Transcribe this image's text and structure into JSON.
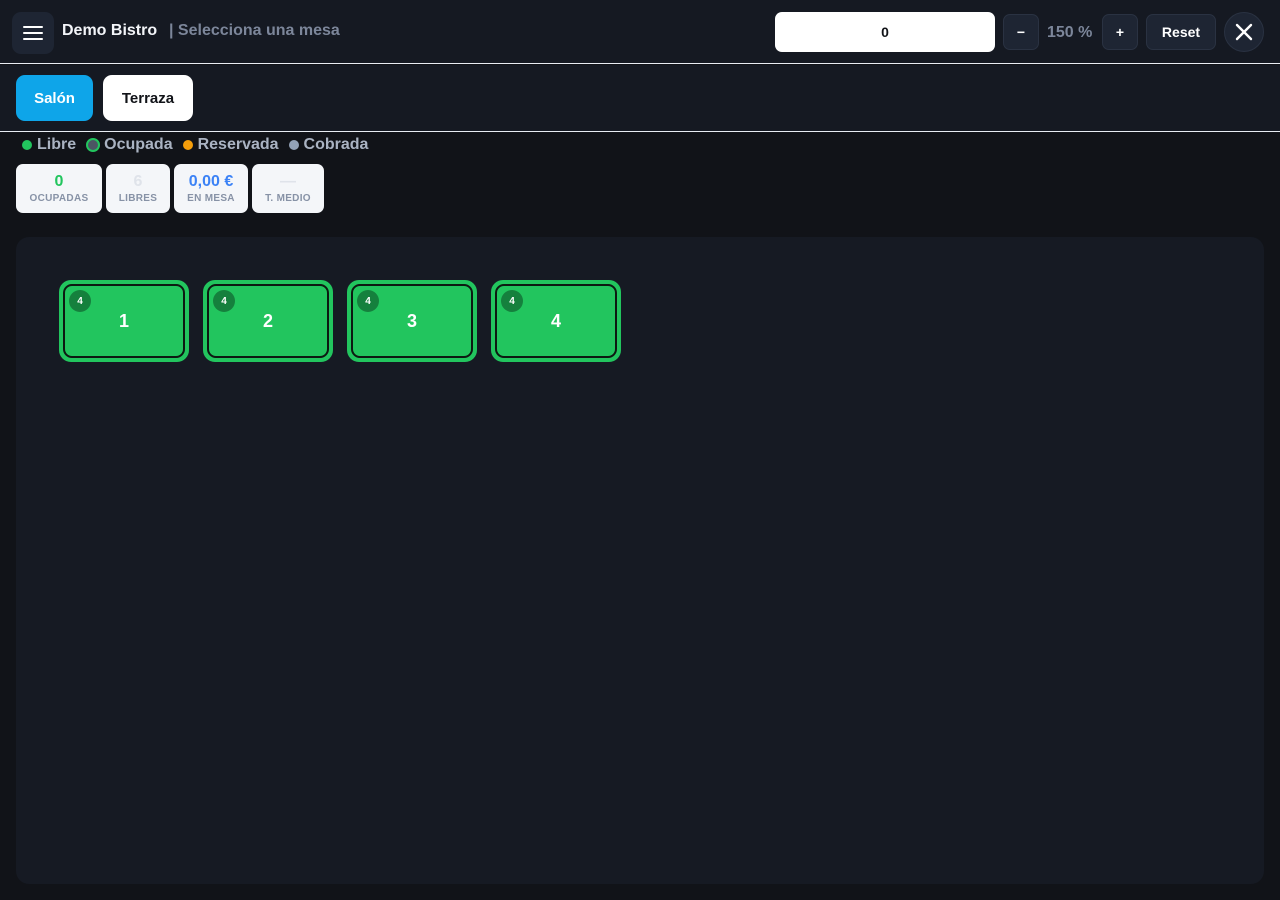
{
  "header": {
    "brand": "Demo Bistro",
    "subtitle": "| Selecciona una mesa",
    "search_value": "0",
    "zoom_out_label": "−",
    "zoom_level": "150 %",
    "zoom_in_label": "+",
    "reset_label": "Reset",
    "menu_icon": "hamburger-icon",
    "close_icon": "close-icon"
  },
  "zones": [
    {
      "label": "Salón",
      "active": true
    },
    {
      "label": "Terraza",
      "active": false
    }
  ],
  "legend": [
    {
      "label": "Libre",
      "color": "#22c55e"
    },
    {
      "label": "Ocupada",
      "color": "#4b5563"
    },
    {
      "label": "Reservada",
      "color": "#f59e0b"
    },
    {
      "label": "Cobrada",
      "color": "#94a3b8"
    }
  ],
  "stats": [
    {
      "value": "0",
      "label": "OCUPADAS",
      "color": "#22c55e"
    },
    {
      "value": "6",
      "label": "LIBRES",
      "color": "#dfe3ea"
    },
    {
      "value": "0,00 €",
      "label": "EN MESA",
      "color": "#3b82f6"
    },
    {
      "value": "—",
      "label": "T. MEDIO",
      "color": "#dfe3ea"
    }
  ],
  "tables": [
    {
      "number": "1",
      "seats": "4",
      "status": "Libre"
    },
    {
      "number": "2",
      "seats": "4",
      "status": "Libre"
    },
    {
      "number": "3",
      "seats": "4",
      "status": "Libre"
    },
    {
      "number": "4",
      "seats": "4",
      "status": "Libre"
    }
  ],
  "colors": {
    "accent": "#0ea5e9",
    "free": "#22c55e",
    "background": "#111318"
  }
}
